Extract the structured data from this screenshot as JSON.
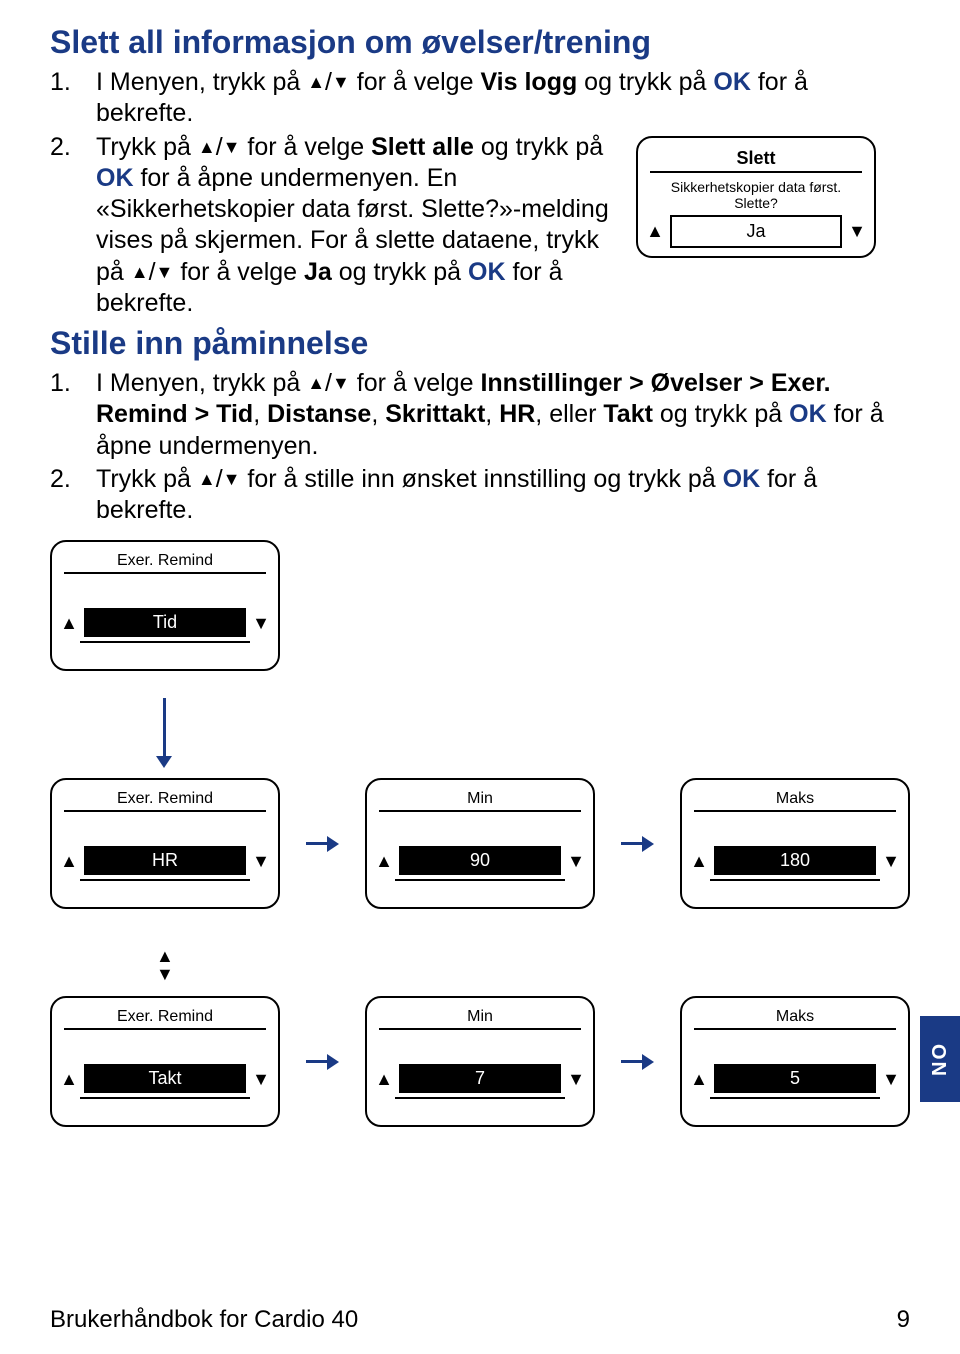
{
  "section1": {
    "heading": "Slett all informasjon om øvelser/trening",
    "step1_pre": "I Menyen, trykk på ",
    "step1_mid": " for å velge ",
    "step1_bold1": "Vis logg",
    "step1_post": " og trykk på ",
    "ok": "OK",
    "step1_end": " for å bekrefte.",
    "step2_pre": "Trykk på ",
    "step2_mid": " for å velge ",
    "step2_bold1": "Slett alle",
    "step2_post1": " og trykk på ",
    "step2_post2": " for å åpne undermenyen. En «Sikkerhetskopier data først. Slette?»-melding vises på skjermen. For å slette dataene, trykk på ",
    "step2_post3": " for å velge ",
    "step2_bold2": "Ja",
    "step2_post4": " og trykk på ",
    "step2_end": " for å bekrefte."
  },
  "device_confirm": {
    "title": "Slett",
    "subtitle": "Sikkerhetskopier data først. Slette?",
    "selected": "Ja"
  },
  "section2": {
    "heading": "Stille inn påminnelse",
    "step1_pre": "I Menyen, trykk på ",
    "step1_mid": " for å velge ",
    "step1_bold1": "Innstillinger > Øvelser > Exer. Remind > Tid",
    "step1_sep": ", ",
    "step1_bold2": "Distanse",
    "step1_bold3": "Skrittakt",
    "step1_bold4": "HR",
    "step1_or": ", eller ",
    "step1_bold5": "Takt",
    "step1_post": " og trykk på ",
    "step1_end": " for å åpne undermenyen.",
    "step2_pre": "Trykk på ",
    "step2_mid": " for å stille inn ønsket innstilling og trykk på ",
    "step2_end": " for å bekrefte."
  },
  "screens": {
    "exer_remind": "Exer. Remind",
    "tid": "Tid",
    "hr": "HR",
    "takt": "Takt",
    "min": "Min",
    "maks": "Maks",
    "val90": "90",
    "val180": "180",
    "val7": "7",
    "val5": "5"
  },
  "side_tab": "NO",
  "footer_left": "Brukerhåndbok for Cardio 40",
  "footer_right": "9"
}
